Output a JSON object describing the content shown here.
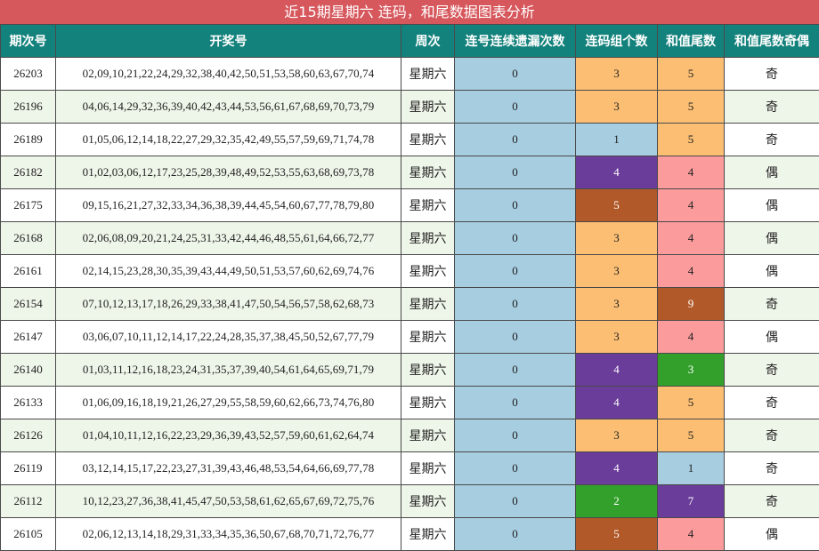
{
  "title": "近15期星期六 连码，和尾数据图表分析",
  "headers": [
    "期次号",
    "开奖号",
    "周次",
    "连号连续遗漏次数",
    "连码组个数",
    "和值尾数",
    "和值尾数奇偶"
  ],
  "colors": {
    "title_bg": "#d6575c",
    "header_bg": "#14827c",
    "miss_bg": "#a7cde1",
    "orange": "#fcbe73",
    "pink": "#fb9b9b",
    "purple": "#6a3d9a",
    "brown": "#b15928",
    "green": "#33a02c",
    "lightblue": "#a7cde1"
  },
  "rows": [
    {
      "issue": "26203",
      "numbers": "02,09,10,21,22,24,29,32,38,40,42,50,51,53,58,60,63,67,70,74",
      "weekday": "星期六",
      "miss": "0",
      "groups": "3",
      "groups_color": "orange",
      "tail": "5",
      "tail_color": "orange",
      "parity": "奇"
    },
    {
      "issue": "26196",
      "numbers": "04,06,14,29,32,36,39,40,42,43,44,53,56,61,67,68,69,70,73,79",
      "weekday": "星期六",
      "miss": "0",
      "groups": "3",
      "groups_color": "orange",
      "tail": "5",
      "tail_color": "orange",
      "parity": "奇"
    },
    {
      "issue": "26189",
      "numbers": "01,05,06,12,14,18,22,27,29,32,35,42,49,55,57,59,69,71,74,78",
      "weekday": "星期六",
      "miss": "0",
      "groups": "1",
      "groups_color": "lightblue",
      "tail": "5",
      "tail_color": "orange",
      "parity": "奇"
    },
    {
      "issue": "26182",
      "numbers": "01,02,03,06,12,17,23,25,28,39,48,49,52,53,55,63,68,69,73,78",
      "weekday": "星期六",
      "miss": "0",
      "groups": "4",
      "groups_color": "purple",
      "tail": "4",
      "tail_color": "pink",
      "parity": "偶"
    },
    {
      "issue": "26175",
      "numbers": "09,15,16,21,27,32,33,34,36,38,39,44,45,54,60,67,77,78,79,80",
      "weekday": "星期六",
      "miss": "0",
      "groups": "5",
      "groups_color": "brown",
      "tail": "4",
      "tail_color": "pink",
      "parity": "偶"
    },
    {
      "issue": "26168",
      "numbers": "02,06,08,09,20,21,24,25,31,33,42,44,46,48,55,61,64,66,72,77",
      "weekday": "星期六",
      "miss": "0",
      "groups": "3",
      "groups_color": "orange",
      "tail": "4",
      "tail_color": "pink",
      "parity": "偶"
    },
    {
      "issue": "26161",
      "numbers": "02,14,15,23,28,30,35,39,43,44,49,50,51,53,57,60,62,69,74,76",
      "weekday": "星期六",
      "miss": "0",
      "groups": "3",
      "groups_color": "orange",
      "tail": "4",
      "tail_color": "pink",
      "parity": "偶"
    },
    {
      "issue": "26154",
      "numbers": "07,10,12,13,17,18,26,29,33,38,41,47,50,54,56,57,58,62,68,73",
      "weekday": "星期六",
      "miss": "0",
      "groups": "3",
      "groups_color": "orange",
      "tail": "9",
      "tail_color": "brown",
      "parity": "奇"
    },
    {
      "issue": "26147",
      "numbers": "03,06,07,10,11,12,14,17,22,24,28,35,37,38,45,50,52,67,77,79",
      "weekday": "星期六",
      "miss": "0",
      "groups": "3",
      "groups_color": "orange",
      "tail": "4",
      "tail_color": "pink",
      "parity": "偶"
    },
    {
      "issue": "26140",
      "numbers": "01,03,11,12,16,18,23,24,31,35,37,39,40,54,61,64,65,69,71,79",
      "weekday": "星期六",
      "miss": "0",
      "groups": "4",
      "groups_color": "purple",
      "tail": "3",
      "tail_color": "green",
      "parity": "奇"
    },
    {
      "issue": "26133",
      "numbers": "01,06,09,16,18,19,21,26,27,29,55,58,59,60,62,66,73,74,76,80",
      "weekday": "星期六",
      "miss": "0",
      "groups": "4",
      "groups_color": "purple",
      "tail": "5",
      "tail_color": "orange",
      "parity": "奇"
    },
    {
      "issue": "26126",
      "numbers": "01,04,10,11,12,16,22,23,29,36,39,43,52,57,59,60,61,62,64,74",
      "weekday": "星期六",
      "miss": "0",
      "groups": "3",
      "groups_color": "orange",
      "tail": "5",
      "tail_color": "orange",
      "parity": "奇"
    },
    {
      "issue": "26119",
      "numbers": "03,12,14,15,17,22,23,27,31,39,43,46,48,53,54,64,66,69,77,78",
      "weekday": "星期六",
      "miss": "0",
      "groups": "4",
      "groups_color": "purple",
      "tail": "1",
      "tail_color": "lightblue",
      "parity": "奇"
    },
    {
      "issue": "26112",
      "numbers": "10,12,23,27,36,38,41,45,47,50,53,58,61,62,65,67,69,72,75,76",
      "weekday": "星期六",
      "miss": "0",
      "groups": "2",
      "groups_color": "green",
      "tail": "7",
      "tail_color": "purple",
      "parity": "奇"
    },
    {
      "issue": "26105",
      "numbers": "02,06,12,13,14,18,29,31,33,34,35,36,50,67,68,70,71,72,76,77",
      "weekday": "星期六",
      "miss": "0",
      "groups": "5",
      "groups_color": "brown",
      "tail": "4",
      "tail_color": "pink",
      "parity": "偶"
    }
  ]
}
